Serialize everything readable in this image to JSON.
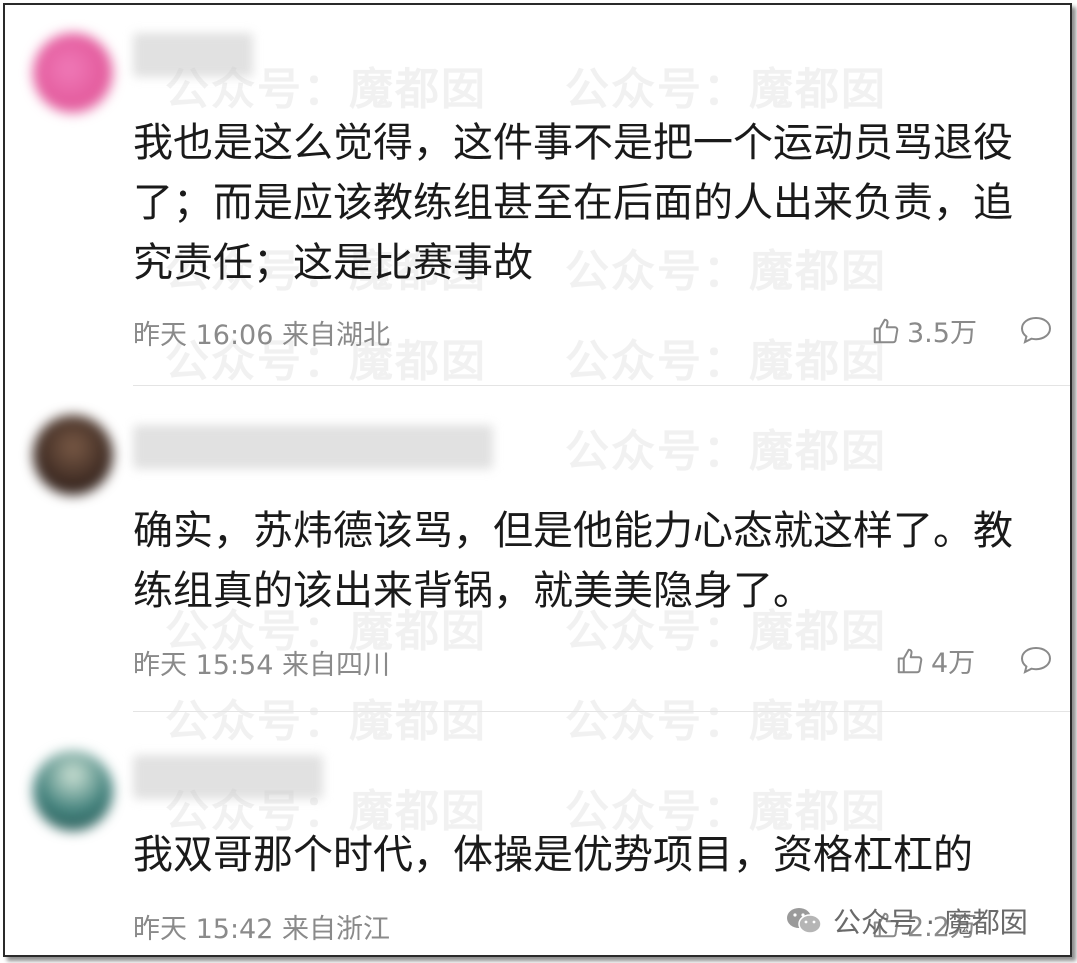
{
  "watermark": {
    "text": "公众号：魔都囡"
  },
  "comments": [
    {
      "text": "我也是这么觉得，这件事不是把一个运动员骂退役了；而是应该教练组甚至在后面的人出来负责，追究责任；这是比赛事故",
      "time": "昨天 16:06 来自湖北",
      "likes": "3.5万"
    },
    {
      "text": "确实，苏炜德该骂，但是他能力心态就这样了。教练组真的该出来背锅，就美美隐身了。",
      "time": "昨天 15:54 来自四川",
      "likes": "4万"
    },
    {
      "text": "我双哥那个时代，体操是优势项目，资格杠杠的",
      "time": "昨天 15:42 来自浙江",
      "likes": "2.2万"
    }
  ],
  "badge": {
    "label": "公众号 · 魔都囡",
    "icon": "wechat-icon"
  },
  "colors": {
    "text": "#1a1a1a",
    "meta": "#8a8a8a",
    "divider": "#e4e4e4"
  }
}
